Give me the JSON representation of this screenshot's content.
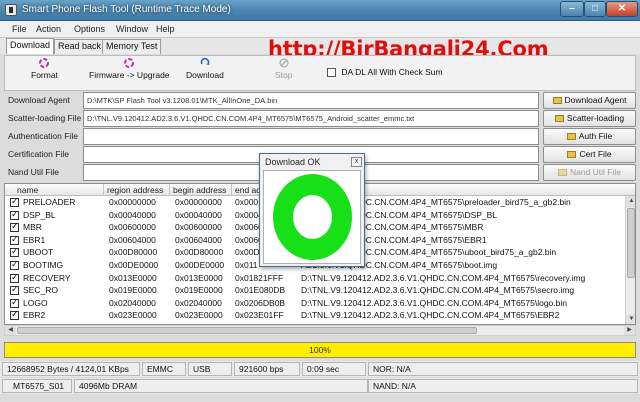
{
  "window": {
    "title": "Smart Phone Flash Tool (Runtime Trace Mode)"
  },
  "menu": [
    "File",
    "Action",
    "Options",
    "Window",
    "Help"
  ],
  "tabs": [
    "Download",
    "Read back",
    "Memory Test"
  ],
  "watermark": "http://BirBangali24.Com",
  "toolbar": {
    "format": "Format",
    "firmware_upgrade": "Firmware -> Upgrade",
    "download": "Download",
    "stop": "Stop",
    "da_dl_check": "DA DL All With Check Sum"
  },
  "fields": {
    "download_agent": {
      "label": "Download Agent",
      "value": "D:\\MTK\\SP Flash Tool v3.1208.01\\MTK_AllInOne_DA.bin",
      "button": "Download Agent"
    },
    "scatter": {
      "label": "Scatter-loading File",
      "value": "D:\\TNL.V9.120412.AD2.3.6.V1.QHDC.CN.COM.4P4_MT6575\\MT6575_Android_scatter_emmc.txt",
      "button": "Scatter-loading"
    },
    "auth": {
      "label": "Authentication File",
      "value": "",
      "button": "Auth File"
    },
    "cert": {
      "label": "Certification File",
      "value": "",
      "button": "Cert File"
    },
    "nand": {
      "label": "Nand Util File",
      "value": "",
      "button": "Nand Util File"
    }
  },
  "table": {
    "columns": [
      "name",
      "region address",
      "begin address",
      "end ad"
    ],
    "rows": [
      {
        "name": "PRELOADER",
        "region": "0x00000000",
        "begin": "0x00000000",
        "end": "0x0001",
        "path": "AD2.3.6.V1.QHDC.CN.COM.4P4_MT6575\\preloader_bird75_a_gb2.bin"
      },
      {
        "name": "DSP_BL",
        "region": "0x00040000",
        "begin": "0x00040000",
        "end": "0x0004",
        "path": "AD2.3.6.V1.QHDC.CN.COM.4P4_MT6575\\DSP_BL"
      },
      {
        "name": "MBR",
        "region": "0x00600000",
        "begin": "0x00600000",
        "end": "0x0060",
        "path": "AD2.3.6.V1.QHDC.CN.COM.4P4_MT6575\\MBR"
      },
      {
        "name": "EBR1",
        "region": "0x00604000",
        "begin": "0x00604000",
        "end": "0x0060",
        "path": "AD2.3.6.V1.QHDC.CN.COM.4P4_MT6575\\EBR1"
      },
      {
        "name": "UBOOT",
        "region": "0x00D80000",
        "begin": "0x00D80000",
        "end": "0x00D",
        "path": "AD2.3.6.V1.QHDC.CN.COM.4P4_MT6575\\uboot_bird75_a_gb2.bin"
      },
      {
        "name": "BOOTIMG",
        "region": "0x00DE0000",
        "begin": "0x00DE0000",
        "end": "0x011",
        "path": "AD2.3.6.V1.QHDC.CN.COM.4P4_MT6575\\boot.img"
      },
      {
        "name": "RECOVERY",
        "region": "0x013E0000",
        "begin": "0x013E0000",
        "end": "0x01821FFF",
        "path": "D:\\TNL.V9.120412.AD2.3.6.V1.QHDC.CN.COM.4P4_MT6575\\recovery.img"
      },
      {
        "name": "SEC_RO",
        "region": "0x019E0000",
        "begin": "0x019E0000",
        "end": "0x01E080DB",
        "path": "D:\\TNL.V9.120412.AD2.3.6.V1.QHDC.CN.COM.4P4_MT6575\\secro.img"
      },
      {
        "name": "LOGO",
        "region": "0x02040000",
        "begin": "0x02040000",
        "end": "0x0206DB0B",
        "path": "D:\\TNL.V9.120412.AD2.3.6.V1.QHDC.CN.COM.4P4_MT6575\\logo.bin"
      },
      {
        "name": "EBR2",
        "region": "0x023E0000",
        "begin": "0x023E0000",
        "end": "0x023E01FF",
        "path": "D:\\TNL.V9.120412.AD2.3.6.V1.QHDC.CN.COM.4P4_MT6575\\EBR2"
      }
    ]
  },
  "progress": {
    "label": "100%",
    "fraction": 1.0,
    "color": "#ffee00"
  },
  "status1": [
    "12668952 Bytes / 4124,01 KBps",
    "EMMC",
    "USB",
    "921600 bps",
    "0:09 sec",
    "NOR: N/A"
  ],
  "status2": [
    "MT6575_S01",
    "4096Mb DRAM",
    "NAND: N/A"
  ],
  "dialog": {
    "title": "Download OK",
    "close": "x",
    "ring_color": "#18e018"
  }
}
